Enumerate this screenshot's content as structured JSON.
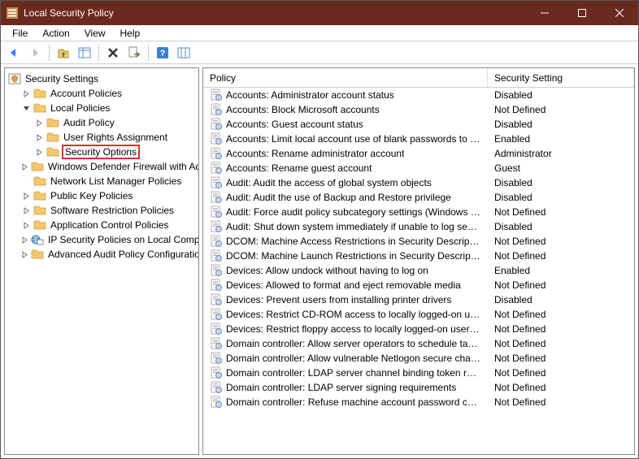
{
  "window": {
    "title": "Local Security Policy"
  },
  "menubar": [
    "File",
    "Action",
    "View",
    "Help"
  ],
  "tree": {
    "root": "Security Settings",
    "items": [
      {
        "indent": 1,
        "expander": "right",
        "label": "Account Policies"
      },
      {
        "indent": 1,
        "expander": "down",
        "label": "Local Policies"
      },
      {
        "indent": 2,
        "expander": "right",
        "label": "Audit Policy"
      },
      {
        "indent": 2,
        "expander": "right",
        "label": "User Rights Assignment"
      },
      {
        "indent": 2,
        "expander": "right",
        "label": "Security Options",
        "selected": true
      },
      {
        "indent": 1,
        "expander": "right",
        "label": "Windows Defender Firewall with Advanced Security"
      },
      {
        "indent": 1,
        "expander": "none",
        "label": "Network List Manager Policies"
      },
      {
        "indent": 1,
        "expander": "right",
        "label": "Public Key Policies"
      },
      {
        "indent": 1,
        "expander": "right",
        "label": "Software Restriction Policies"
      },
      {
        "indent": 1,
        "expander": "right",
        "label": "Application Control Policies"
      },
      {
        "indent": 1,
        "expander": "right",
        "label": "IP Security Policies on Local Computer",
        "icon": "globe"
      },
      {
        "indent": 1,
        "expander": "right",
        "label": "Advanced Audit Policy Configuration"
      }
    ]
  },
  "list": {
    "columns": [
      "Policy",
      "Security Setting"
    ],
    "rows": [
      {
        "policy": "Accounts: Administrator account status",
        "setting": "Disabled"
      },
      {
        "policy": "Accounts: Block Microsoft accounts",
        "setting": "Not Defined"
      },
      {
        "policy": "Accounts: Guest account status",
        "setting": "Disabled"
      },
      {
        "policy": "Accounts: Limit local account use of blank passwords to co...",
        "setting": "Enabled"
      },
      {
        "policy": "Accounts: Rename administrator account",
        "setting": "Administrator"
      },
      {
        "policy": "Accounts: Rename guest account",
        "setting": "Guest"
      },
      {
        "policy": "Audit: Audit the access of global system objects",
        "setting": "Disabled"
      },
      {
        "policy": "Audit: Audit the use of Backup and Restore privilege",
        "setting": "Disabled"
      },
      {
        "policy": "Audit: Force audit policy subcategory settings (Windows Vis...",
        "setting": "Not Defined"
      },
      {
        "policy": "Audit: Shut down system immediately if unable to log secur...",
        "setting": "Disabled"
      },
      {
        "policy": "DCOM: Machine Access Restrictions in Security Descriptor D...",
        "setting": "Not Defined"
      },
      {
        "policy": "DCOM: Machine Launch Restrictions in Security Descriptor ...",
        "setting": "Not Defined"
      },
      {
        "policy": "Devices: Allow undock without having to log on",
        "setting": "Enabled"
      },
      {
        "policy": "Devices: Allowed to format and eject removable media",
        "setting": "Not Defined"
      },
      {
        "policy": "Devices: Prevent users from installing printer drivers",
        "setting": "Disabled"
      },
      {
        "policy": "Devices: Restrict CD-ROM access to locally logged-on user ...",
        "setting": "Not Defined"
      },
      {
        "policy": "Devices: Restrict floppy access to locally logged-on user only",
        "setting": "Not Defined"
      },
      {
        "policy": "Domain controller: Allow server operators to schedule tasks",
        "setting": "Not Defined"
      },
      {
        "policy": "Domain controller: Allow vulnerable Netlogon secure chann...",
        "setting": "Not Defined"
      },
      {
        "policy": "Domain controller: LDAP server channel binding token requi...",
        "setting": "Not Defined"
      },
      {
        "policy": "Domain controller: LDAP server signing requirements",
        "setting": "Not Defined"
      },
      {
        "policy": "Domain controller: Refuse machine account password chan...",
        "setting": "Not Defined"
      }
    ]
  }
}
